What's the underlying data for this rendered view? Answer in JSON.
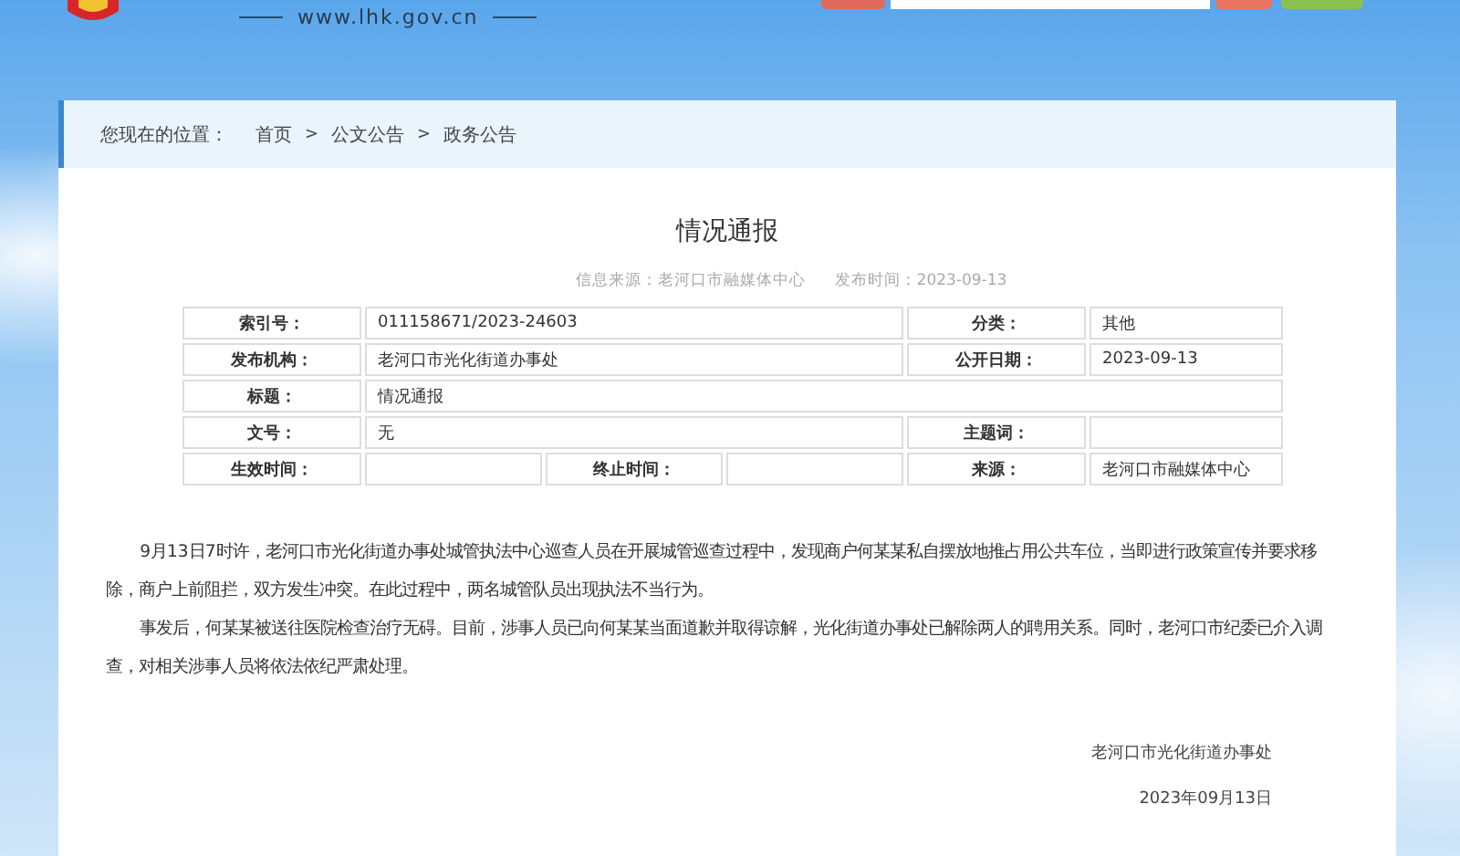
{
  "header": {
    "site_url": "www.lhk.gov.cn"
  },
  "breadcrumb": {
    "label": "您现在的位置：",
    "items": [
      {
        "text": "首页",
        "kind": "link"
      },
      {
        "text": ">",
        "kind": "separator"
      },
      {
        "text": "公文公告",
        "kind": "link"
      },
      {
        "text": ">",
        "kind": "separator"
      },
      {
        "text": "政务公告",
        "kind": "link"
      }
    ]
  },
  "article": {
    "title": "情况通报",
    "meta": [
      "信息来源：老河口市融媒体中心",
      "发布时间：2023-09-13"
    ],
    "info_table": [
      [
        {
          "kind": "label",
          "text": "索引号："
        },
        {
          "kind": "value_wide",
          "text": "011158671/2023-24603"
        },
        {
          "kind": "label",
          "text": "分类："
        },
        {
          "kind": "value",
          "text": "其他"
        }
      ],
      [
        {
          "kind": "label",
          "text": "发布机构："
        },
        {
          "kind": "value_wide",
          "text": "老河口市光化街道办事处"
        },
        {
          "kind": "label",
          "text": "公开日期："
        },
        {
          "kind": "value",
          "text": "2023-09-13"
        }
      ],
      [
        {
          "kind": "label",
          "text": "标题："
        },
        {
          "kind": "value_full",
          "text": "情况通报"
        }
      ],
      [
        {
          "kind": "label",
          "text": "文号："
        },
        {
          "kind": "value_wide",
          "text": "无"
        },
        {
          "kind": "label",
          "text": "主题词："
        },
        {
          "kind": "value"
        }
      ],
      [
        {
          "kind": "label",
          "text": "生效时间："
        },
        {
          "kind": "value"
        },
        {
          "kind": "label",
          "text": "终止时间："
        },
        {
          "kind": "value"
        },
        {
          "kind": "label",
          "text": "来源："
        },
        {
          "kind": "value",
          "text": "老河口市融媒体中心"
        }
      ]
    ],
    "paragraphs": [
      "9月13日7时许，老河口市光化街道办事处城管执法中心巡查人员在开展城管巡查过程中，发现商户何某某私自摆放地推占用公共车位，当即进行政策宣传并要求移除，商户上前阻拦，双方发生冲突。在此过程中，两名城管队员出现执法不当行为。",
      "事发后，何某某被送往医院检查治疗无碍。目前，涉事人员已向何某某当面道歉并取得谅解，光化街道办事处已解除两人的聘用关系。同时，老河口市纪委已介入调查，对相关涉事人员将依法依纪严肃处理。"
    ],
    "signature": [
      "老河口市光化街道办事处",
      "2023年09月13日"
    ]
  }
}
